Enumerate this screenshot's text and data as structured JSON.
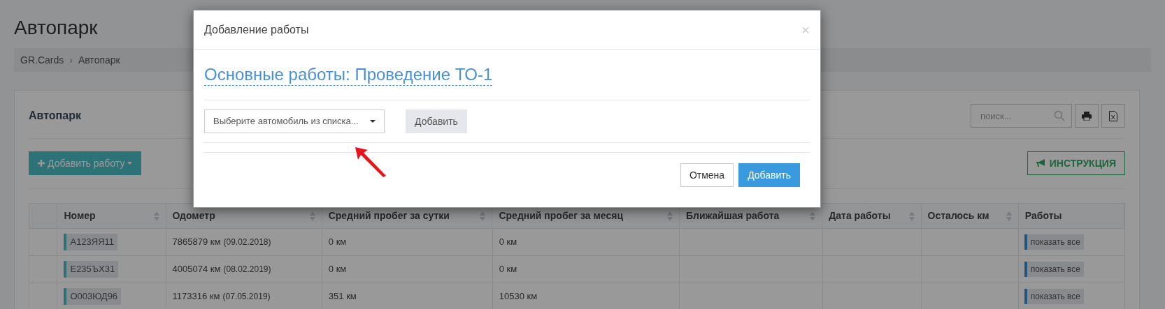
{
  "page": {
    "title": "Автопарк"
  },
  "breadcrumb": {
    "separator": "›",
    "items": [
      "GR.Cards",
      "Автопарк"
    ]
  },
  "panel": {
    "title": "Автопарк",
    "search": {
      "placeholder": "поиск..."
    },
    "add_button": "Добавить работу",
    "instruction_button": "ИНСТРУКЦИЯ"
  },
  "table": {
    "columns": [
      {
        "label": "Номер",
        "sortable": true
      },
      {
        "label": "Одометр",
        "sortable": true
      },
      {
        "label": "Средний пробег за сутки",
        "sortable": true
      },
      {
        "label": "Средний пробег за месяц",
        "sortable": true
      },
      {
        "label": "Ближайшая работа",
        "sortable": true
      },
      {
        "label": "Дата работы",
        "sortable": true
      },
      {
        "label": "Осталось км",
        "sortable": true
      },
      {
        "label": "Работы",
        "sortable": false
      }
    ],
    "rows": [
      {
        "plate": "А123ЯЯ11",
        "odometer": "7865879 км",
        "odometer_date": "(09.02.2018)",
        "per_day": "0 км",
        "per_month": "0 км",
        "works": "показать все"
      },
      {
        "plate": "Е235ЪХ31",
        "odometer": "4005074 км",
        "odometer_date": "(08.02.2019)",
        "per_day": "0 км",
        "per_month": "0 км",
        "works": "показать все"
      },
      {
        "plate": "О003ЮД96",
        "odometer": "1173316 км",
        "odometer_date": "(07.05.2019)",
        "per_day": "351 км",
        "per_month": "10530 км",
        "works": "показать все"
      }
    ]
  },
  "modal": {
    "title": "Добавление работы",
    "close": "×",
    "heading": "Основные работы: Проведение ТО-1",
    "select": {
      "placeholder": "Выберите автомобиль из списка..."
    },
    "inline_button": "Добавить",
    "cancel_button": "Отмена",
    "submit_button": "Добавить"
  }
}
